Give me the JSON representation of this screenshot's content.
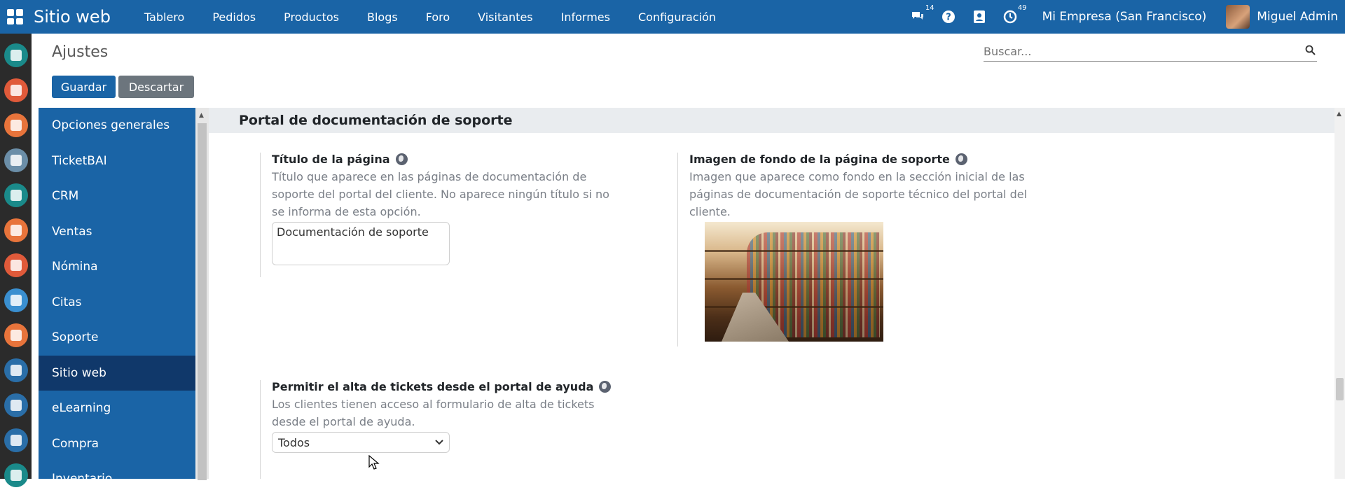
{
  "topbar": {
    "brand": "Sitio web",
    "menu": [
      "Tablero",
      "Pedidos",
      "Productos",
      "Blogs",
      "Foro",
      "Visitantes",
      "Informes",
      "Configuración"
    ],
    "messages_count": "14",
    "activities_count": "49",
    "company": "Mi Empresa (San Francisco)",
    "user": "Miguel Admin",
    "icons": [
      "apps-grid-icon",
      "chat-icon",
      "help-icon",
      "contacts-icon",
      "activity-clock-icon"
    ]
  },
  "rail": {
    "apps": [
      {
        "icon": "discuss-app-icon",
        "color": "#1a8a8a"
      },
      {
        "icon": "calendar-app-icon",
        "color": "#e05a3a"
      },
      {
        "icon": "notes-app-icon",
        "color": "#e8743b"
      },
      {
        "icon": "contacts-app-icon",
        "color": "#6b8ea8"
      },
      {
        "icon": "crm-app-icon",
        "color": "#1a8a8a"
      },
      {
        "icon": "sales-app-icon",
        "color": "#e8743b"
      },
      {
        "icon": "dashboards-app-icon",
        "color": "#e05a3a"
      },
      {
        "icon": "appointments-app-icon",
        "color": "#3a8fd0"
      },
      {
        "icon": "helpdesk-app-icon",
        "color": "#e8743b"
      },
      {
        "icon": "pos-app-icon",
        "color": "#2a6ea8"
      },
      {
        "icon": "accounting-app-icon",
        "color": "#2a6ea8"
      },
      {
        "icon": "planning-app-icon",
        "color": "#2a6ea8"
      },
      {
        "icon": "inventory-app-icon",
        "color": "#1a8a8a"
      }
    ]
  },
  "control": {
    "breadcrumb": "Ajustes",
    "save": "Guardar",
    "discard": "Descartar",
    "search_placeholder": "Buscar..."
  },
  "sidebar": {
    "items": [
      {
        "label": "Opciones generales",
        "active": false
      },
      {
        "label": "TicketBAI",
        "active": false
      },
      {
        "label": "CRM",
        "active": false
      },
      {
        "label": "Ventas",
        "active": false
      },
      {
        "label": "Nómina",
        "active": false
      },
      {
        "label": "Citas",
        "active": false
      },
      {
        "label": "Soporte",
        "active": false
      },
      {
        "label": "Sitio web",
        "active": true
      },
      {
        "label": "eLearning",
        "active": false
      },
      {
        "label": "Compra",
        "active": false
      },
      {
        "label": "Inventario",
        "active": false
      }
    ]
  },
  "main": {
    "section_title": "Portal de documentación de soporte",
    "page_title": {
      "title": "Título de la página",
      "description": "Título que aparece en las páginas de documentación de soporte del portal del cliente. No aparece ningún título si no se informa de esta opción.",
      "value": "Documentación de soporte"
    },
    "background_image": {
      "title": "Imagen de fondo de la página de soporte",
      "description": "Imagen que aparece como fondo en la sección inicial de las páginas de documentación de soporte técnico del portal del cliente."
    },
    "ticket_submission": {
      "title": "Permitir el alta de tickets desde el portal de ayuda",
      "description": "Los clientes tienen acceso al formulario de alta de tickets desde el portal de ayuda.",
      "selected": "Todos"
    }
  }
}
